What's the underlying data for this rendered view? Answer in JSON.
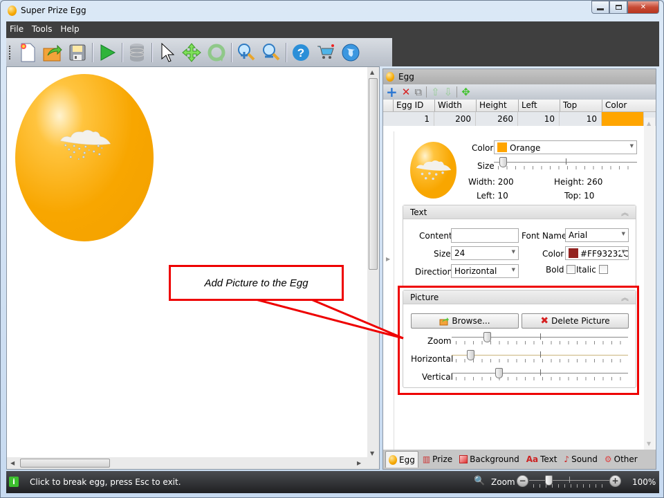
{
  "window": {
    "title": "Super Prize Egg",
    "controls": {
      "minimize": "—",
      "maximize": "▫",
      "close": "✕"
    }
  },
  "menu": [
    "File",
    "Tools",
    "Help"
  ],
  "toolbar": [
    {
      "name": "new-icon",
      "glyph": "🗋"
    },
    {
      "name": "open-icon",
      "glyph": "📂"
    },
    {
      "name": "save-icon",
      "glyph": "💾"
    },
    {
      "name": "play-icon",
      "glyph": "▶"
    },
    {
      "name": "database-icon",
      "glyph": "⛁"
    },
    {
      "name": "select-pointer-icon",
      "glyph": "↖"
    },
    {
      "name": "move-icon",
      "glyph": "✥"
    },
    {
      "name": "rotate-icon",
      "glyph": "⟳"
    },
    {
      "name": "zoom-in-icon",
      "glyph": "🔍"
    },
    {
      "name": "zoom-out-icon",
      "glyph": "🔍"
    },
    {
      "name": "help-icon",
      "glyph": "?"
    },
    {
      "name": "cart-icon",
      "glyph": "🛒"
    },
    {
      "name": "web-icon",
      "glyph": "🌐"
    }
  ],
  "panel": {
    "title": "Egg",
    "tools": {
      "add": "+",
      "delete": "✕",
      "copy": "⧉",
      "up": "⇧",
      "down": "⇩",
      "move": "✥"
    },
    "grid": {
      "columns": [
        "Egg ID",
        "Width",
        "Height",
        "Left",
        "Top",
        "Color"
      ],
      "rows": [
        {
          "id": "1",
          "width": "200",
          "height": "260",
          "left": "10",
          "top": "10",
          "color": "#FFA500"
        }
      ]
    },
    "egg": {
      "color_label": "Color",
      "color_value": "Orange",
      "color_swatch": "#FFA500",
      "size_label": "Size",
      "size_value": 0.04,
      "width_text": "Width: 200",
      "height_text": "Height: 260",
      "left_text": "Left: 10",
      "top_text": "Top: 10"
    },
    "text_group": {
      "title": "Text",
      "content_label": "Content",
      "content_value": "",
      "font_label": "Font Name",
      "font_value": "Arial",
      "size_label": "Size",
      "size_value": "24",
      "color_label": "Color",
      "color_value": "#FF93232C",
      "color_swatch": "#932320",
      "direction_label": "Direction",
      "direction_value": "Horizontal",
      "bold_label": "Bold",
      "italic_label": "Italic"
    },
    "picture_group": {
      "title": "Picture",
      "browse_label": "Browse...",
      "delete_label": "Delete Picture",
      "zoom_label": "Zoom",
      "zoom_value": 0.19,
      "horizontal_label": "Horizontal",
      "horizontal_value": 0.09,
      "vertical_label": "Vertical",
      "vertical_value": 0.26
    },
    "tabs": [
      {
        "name": "egg",
        "label": "Egg",
        "glyph": "●",
        "active": true
      },
      {
        "name": "prize",
        "label": "Prize",
        "glyph": "🎁"
      },
      {
        "name": "background",
        "label": "Background",
        "glyph": "🖼"
      },
      {
        "name": "text",
        "label": "Text",
        "glyph": "A"
      },
      {
        "name": "sound",
        "label": "Sound",
        "glyph": "♪"
      },
      {
        "name": "other",
        "label": "Other",
        "glyph": "⚙"
      }
    ]
  },
  "callout": {
    "text": "Add Picture to the Egg"
  },
  "status": {
    "message": "Click to break egg, press Esc to exit.",
    "zoom_label": "Zoom",
    "zoom_value": "100%",
    "zoom_slider": 0.22
  }
}
